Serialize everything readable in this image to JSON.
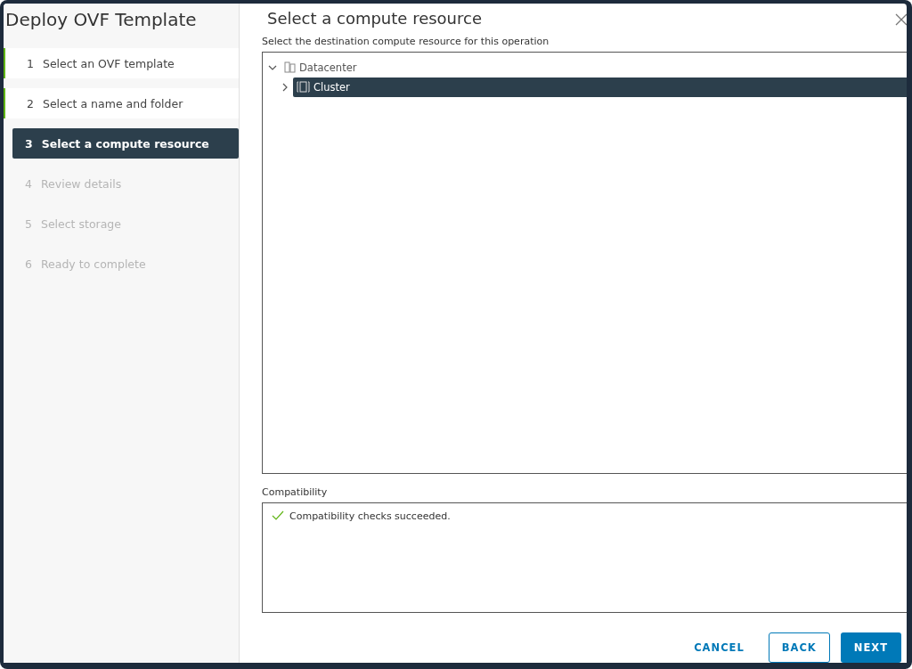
{
  "window": {
    "title": "Deploy OVF Template"
  },
  "steps": [
    {
      "number": "1",
      "label": "Select an OVF template",
      "completed": true,
      "selected": false,
      "disabled": false
    },
    {
      "number": "2",
      "label": "Select a name and folder",
      "completed": true,
      "selected": false,
      "disabled": false
    },
    {
      "number": "3",
      "label": "Select a compute resource",
      "completed": false,
      "selected": true,
      "disabled": false
    },
    {
      "number": "4",
      "label": "Review details",
      "completed": false,
      "selected": false,
      "disabled": true
    },
    {
      "number": "5",
      "label": "Select storage",
      "completed": false,
      "selected": false,
      "disabled": true
    },
    {
      "number": "6",
      "label": "Ready to complete",
      "completed": false,
      "selected": false,
      "disabled": true
    }
  ],
  "page": {
    "heading": "Select a compute resource",
    "instruction": "Select the destination compute resource for this operation"
  },
  "tree": [
    {
      "label": "Datacenter",
      "kind": "datacenter",
      "expanded": true,
      "selected": false,
      "children": [
        {
          "label": "Cluster",
          "kind": "cluster",
          "expanded": false,
          "selected": true
        }
      ]
    }
  ],
  "compatibility": {
    "label": "Compatibility",
    "message": "Compatibility checks succeeded.",
    "success": true
  },
  "buttons": [
    {
      "label": "CANCEL",
      "kind": "flat"
    },
    {
      "label": "BACK",
      "kind": "outline"
    },
    {
      "label": "NEXT",
      "kind": "primary"
    }
  ]
}
